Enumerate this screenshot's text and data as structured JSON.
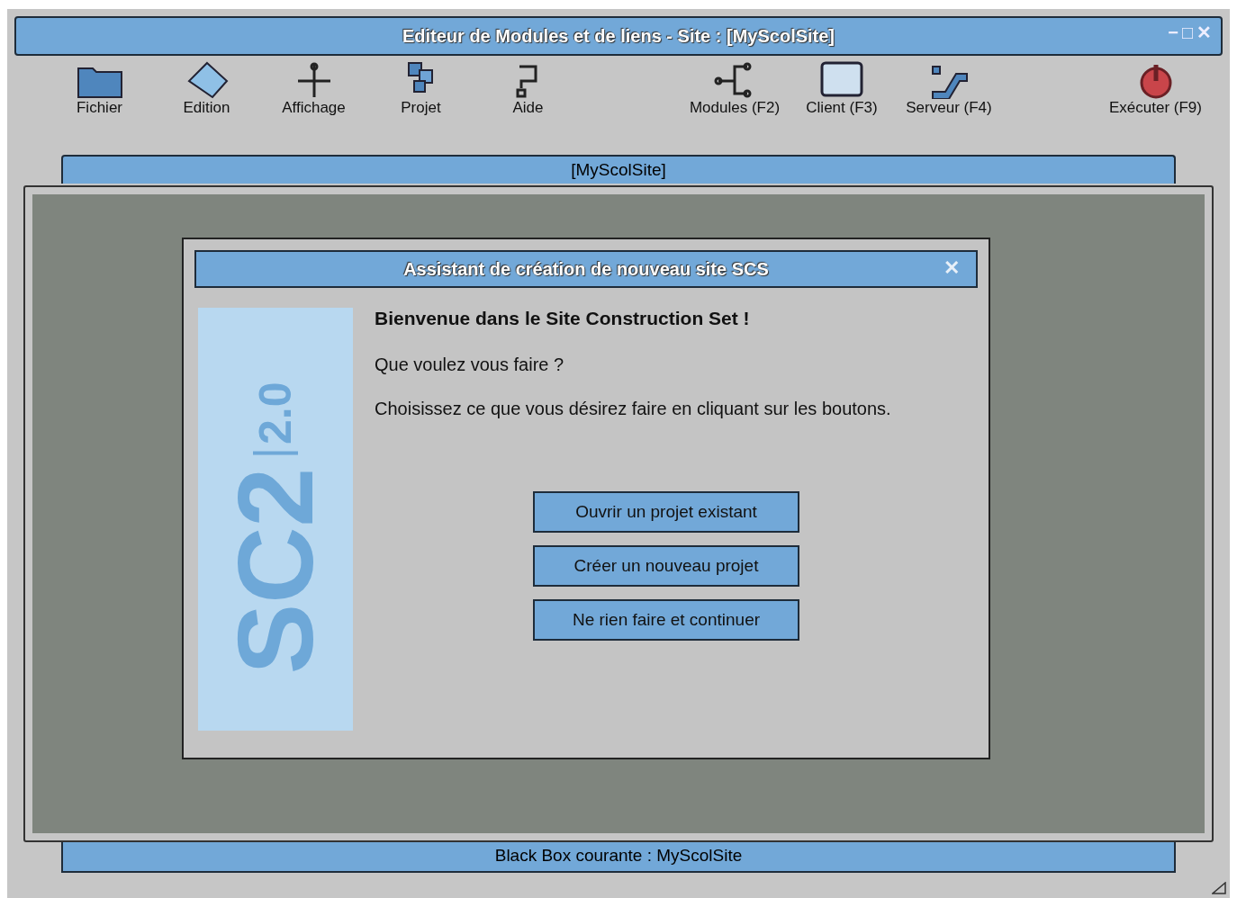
{
  "window": {
    "title": "Editeur de Modules et de liens - Site : [MyScolSite]",
    "controls": [
      "−",
      "□",
      "✕"
    ]
  },
  "toolbar": {
    "left": [
      "Fichier",
      "Edition",
      "Affichage",
      "Projet",
      "Aide"
    ],
    "middle": [
      "Modules (F2)",
      "Client (F3)",
      "Serveur (F4)"
    ],
    "right": [
      "Exécuter (F9)"
    ]
  },
  "tab": {
    "label": "[MyScolSite]"
  },
  "dialog": {
    "title": "Assistant de création de nouveau site SCS",
    "close": "✕",
    "logo": {
      "name": "SC2",
      "version": "2.0"
    },
    "heading": "Bienvenue dans le Site Construction Set !",
    "question": "Que voulez vous faire ?",
    "instructions": "Choisissez ce que vous désirez faire en cliquant sur les boutons.",
    "buttons": [
      "Ouvrir un projet existant",
      "Créer un nouveau projet",
      "Ne rien faire et continuer"
    ]
  },
  "status_bar": "Black Box courante : MyScolSite"
}
